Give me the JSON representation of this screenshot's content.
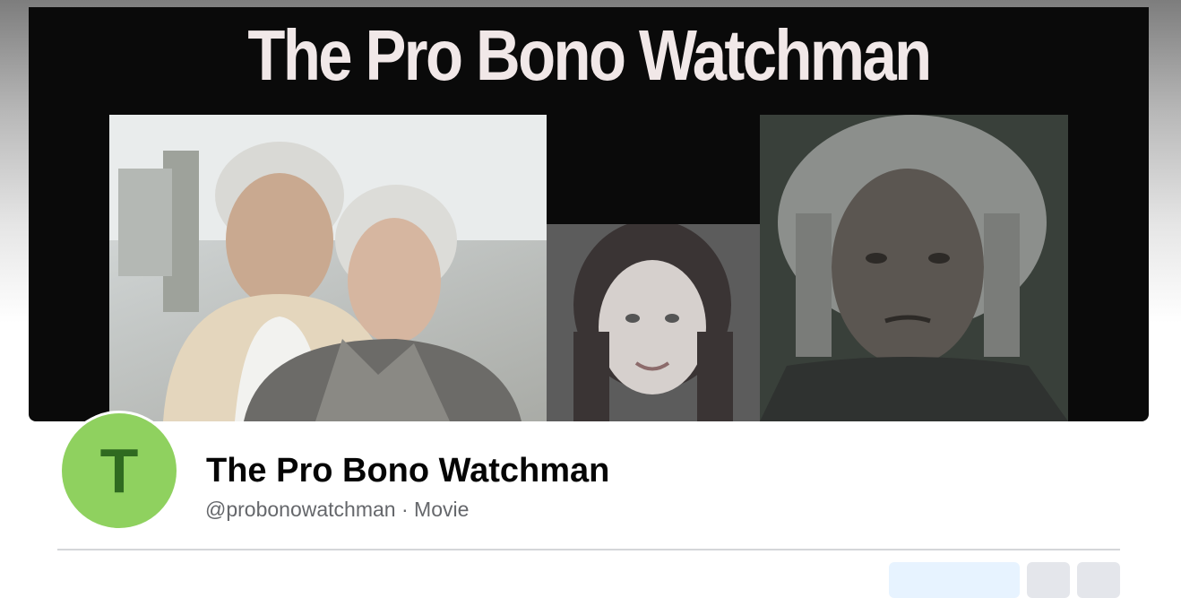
{
  "cover": {
    "title": "The Pro Bono Watchman"
  },
  "profile": {
    "avatar_letter": "T",
    "name": "The Pro Bono Watchman",
    "handle": "@probonowatchman",
    "category": "Movie",
    "separator": "·"
  },
  "icons": {
    "avatar": "letter-avatar"
  },
  "colors": {
    "avatar_bg": "#8fd15f",
    "avatar_letter": "#2f6a20",
    "cover_bg": "#0a0a0a",
    "meta_text": "#65676b"
  }
}
